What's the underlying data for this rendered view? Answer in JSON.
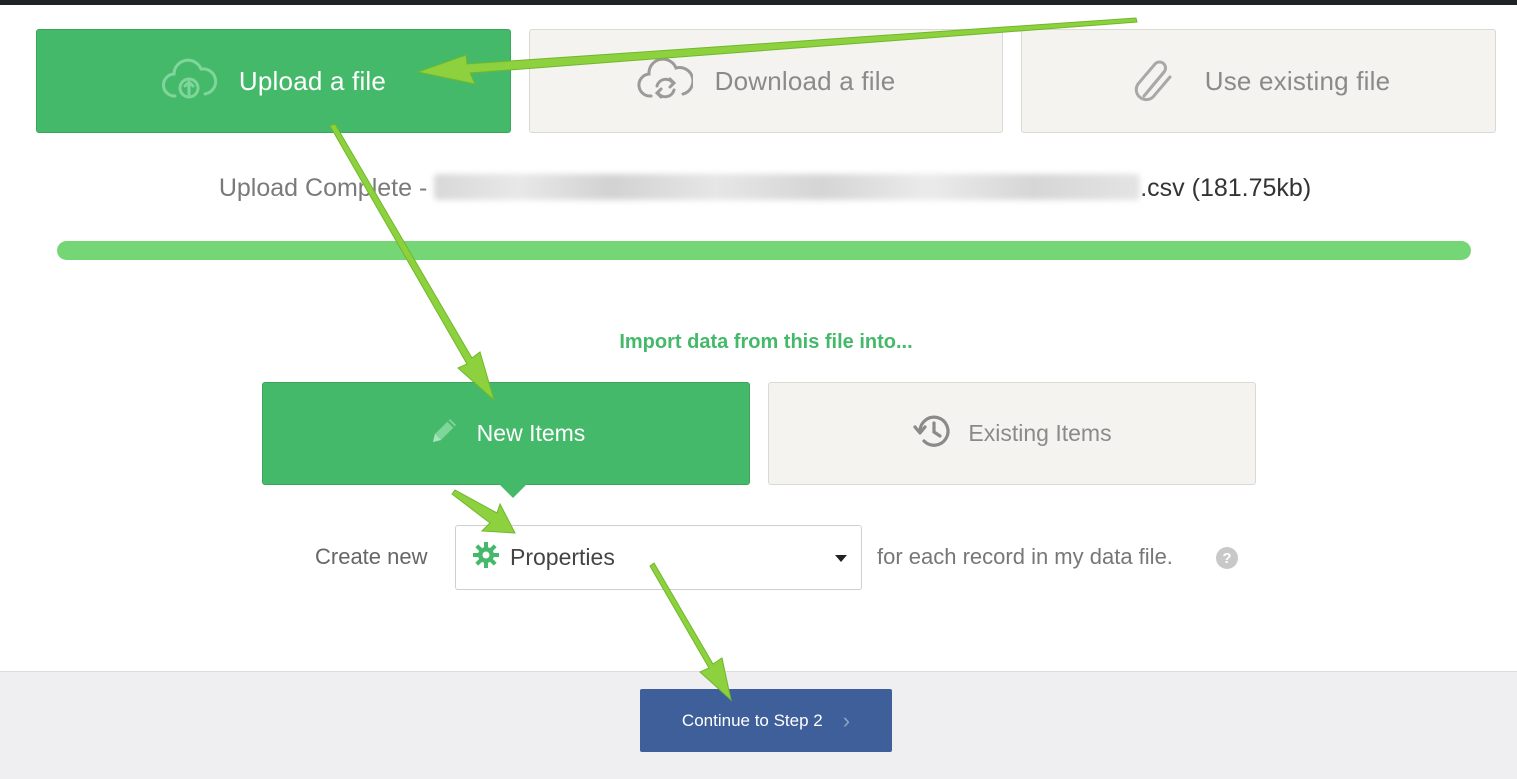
{
  "source_options": [
    {
      "label": "Upload a file",
      "icon": "cloud-upload-icon",
      "active": true
    },
    {
      "label": "Download a file",
      "icon": "cloud-sync-icon",
      "active": false
    },
    {
      "label": "Use existing file",
      "icon": "paperclip-icon",
      "active": false
    }
  ],
  "upload": {
    "status_prefix": "Upload Complete - ",
    "filename_suffix": ".csv",
    "file_size": " (181.75kb)",
    "progress_percent": 100
  },
  "import": {
    "label": "Import data from this file into...",
    "modes": [
      {
        "label": "New Items",
        "icon": "pencil-icon",
        "active": true
      },
      {
        "label": "Existing Items",
        "icon": "history-icon",
        "active": false
      }
    ]
  },
  "create_row": {
    "prefix": "Create new",
    "selected": "Properties",
    "selected_icon": "gear-icon",
    "suffix": "for each record in my data file.",
    "help": "?"
  },
  "footer": {
    "continue_label": "Continue to Step 2",
    "continue_icon": "chevron-right-icon"
  },
  "colors": {
    "green": "#45b96a",
    "progress": "#74d674",
    "continue": "#3f5f9a",
    "annotation_arrow": "#8ed13f"
  }
}
